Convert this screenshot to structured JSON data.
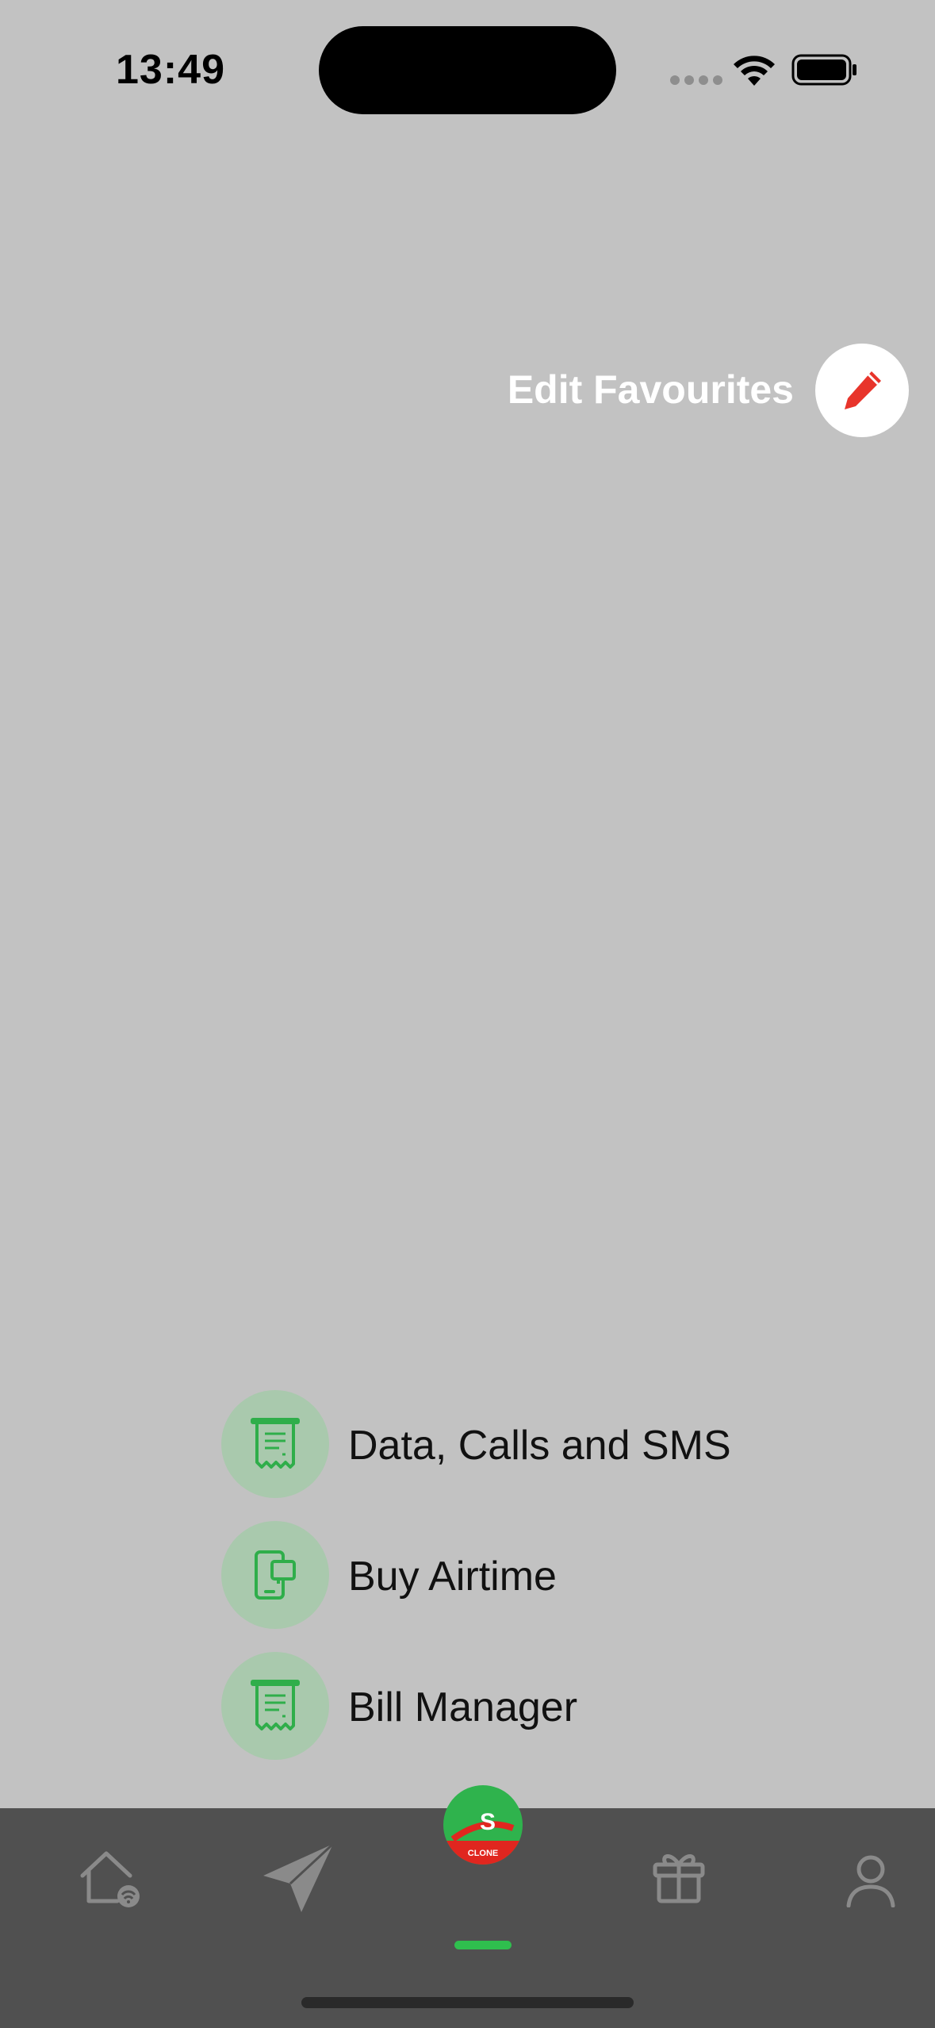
{
  "status_bar": {
    "time": "13:49"
  },
  "edit_favourites": {
    "label": "Edit Favourites"
  },
  "actions": [
    {
      "label": "Data, Calls and SMS",
      "icon": "receipt-icon"
    },
    {
      "label": "Buy Airtime",
      "icon": "phone-topup-icon"
    },
    {
      "label": "Bill Manager",
      "icon": "receipt-icon"
    }
  ],
  "tab_bar": {
    "tabs": [
      "home-wifi-icon",
      "send-icon",
      "app-logo",
      "gift-icon",
      "profile-icon"
    ],
    "logo_letter": "S",
    "logo_text": "CLONE"
  },
  "colors": {
    "overlay_bg": "#c2c2c2",
    "accent_green": "#2fbf4e",
    "edit_icon_red": "#e8342b",
    "tab_bar_bg": "#505050"
  }
}
